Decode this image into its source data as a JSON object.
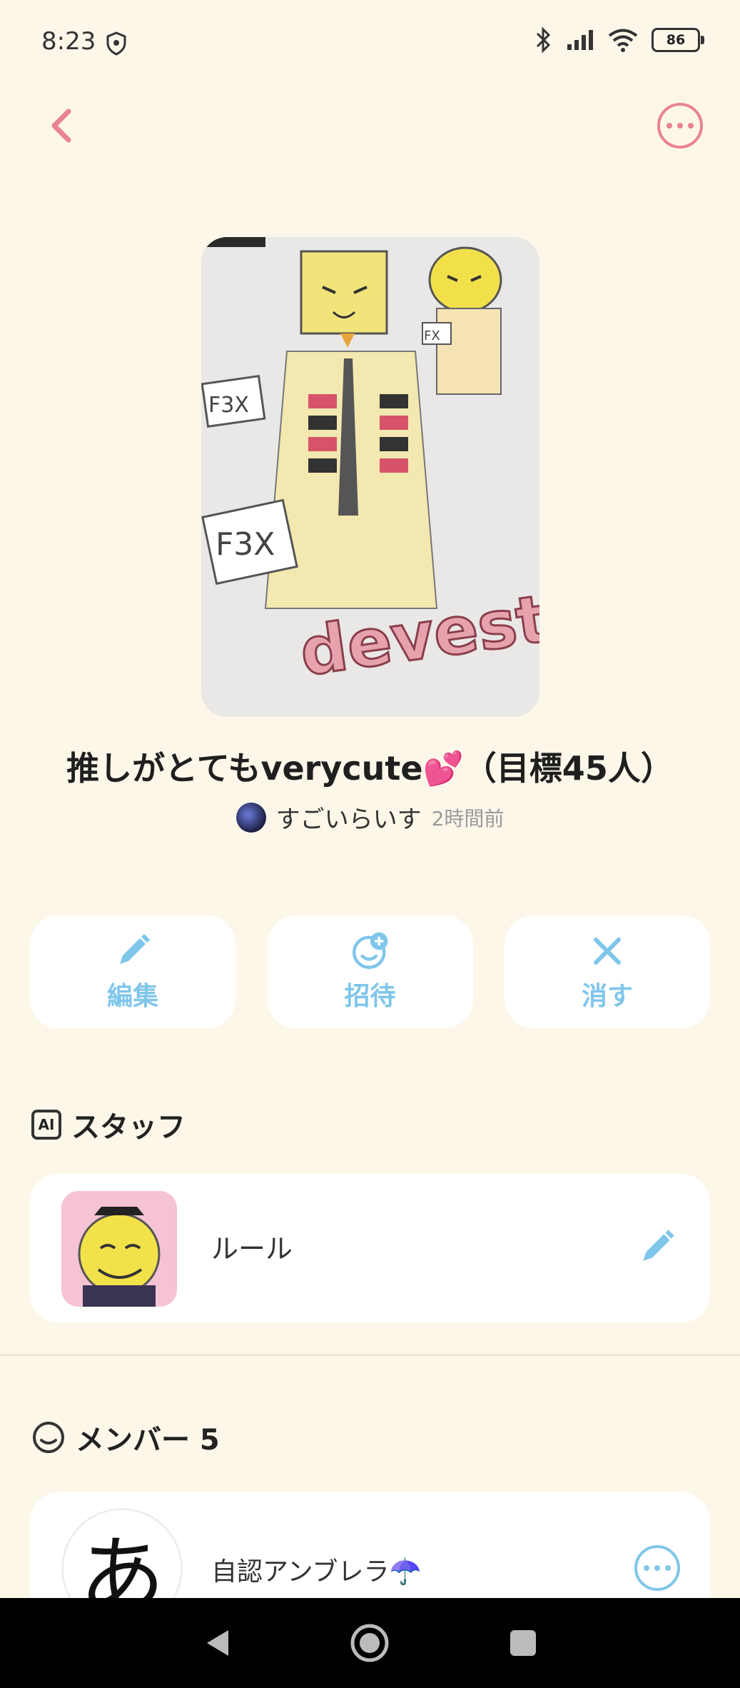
{
  "status": {
    "time": "8:23",
    "battery": "86"
  },
  "post": {
    "title": "推しがとてもverycute💕（目標45人）",
    "author": "すごいらいす",
    "time_ago": "2時間前"
  },
  "cover_text": {
    "sign1": "F3X",
    "sign2": "F3X",
    "sign3": "FX",
    "logo": "devest"
  },
  "actions": {
    "edit": "編集",
    "invite": "招待",
    "delete": "消す"
  },
  "staff": {
    "title": "スタッフ",
    "badge": "AI",
    "item_name": "ルール"
  },
  "members": {
    "title": "メンバー 5",
    "first_name": "自認アンブレラ☂️",
    "first_avatar": "あ"
  },
  "colors": {
    "accent_pink": "#e9838f",
    "accent_blue": "#7fc6ea",
    "background": "#fdf7ea"
  }
}
